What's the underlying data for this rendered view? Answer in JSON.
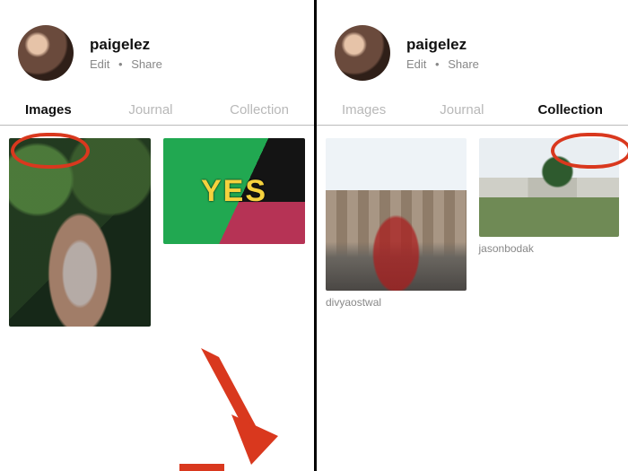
{
  "left": {
    "username": "paigelez",
    "edit": "Edit",
    "share": "Share",
    "dot": "•",
    "tabs": {
      "images": "Images",
      "journal": "Journal",
      "collection": "Collection"
    },
    "yes_text": "YES"
  },
  "right": {
    "username": "paigelez",
    "edit": "Edit",
    "share": "Share",
    "dot": "•",
    "tabs": {
      "images": "Images",
      "journal": "Journal",
      "collection": "Collection"
    },
    "captions": {
      "c1": "divyaostwal",
      "c2": "jasonbodak"
    }
  }
}
